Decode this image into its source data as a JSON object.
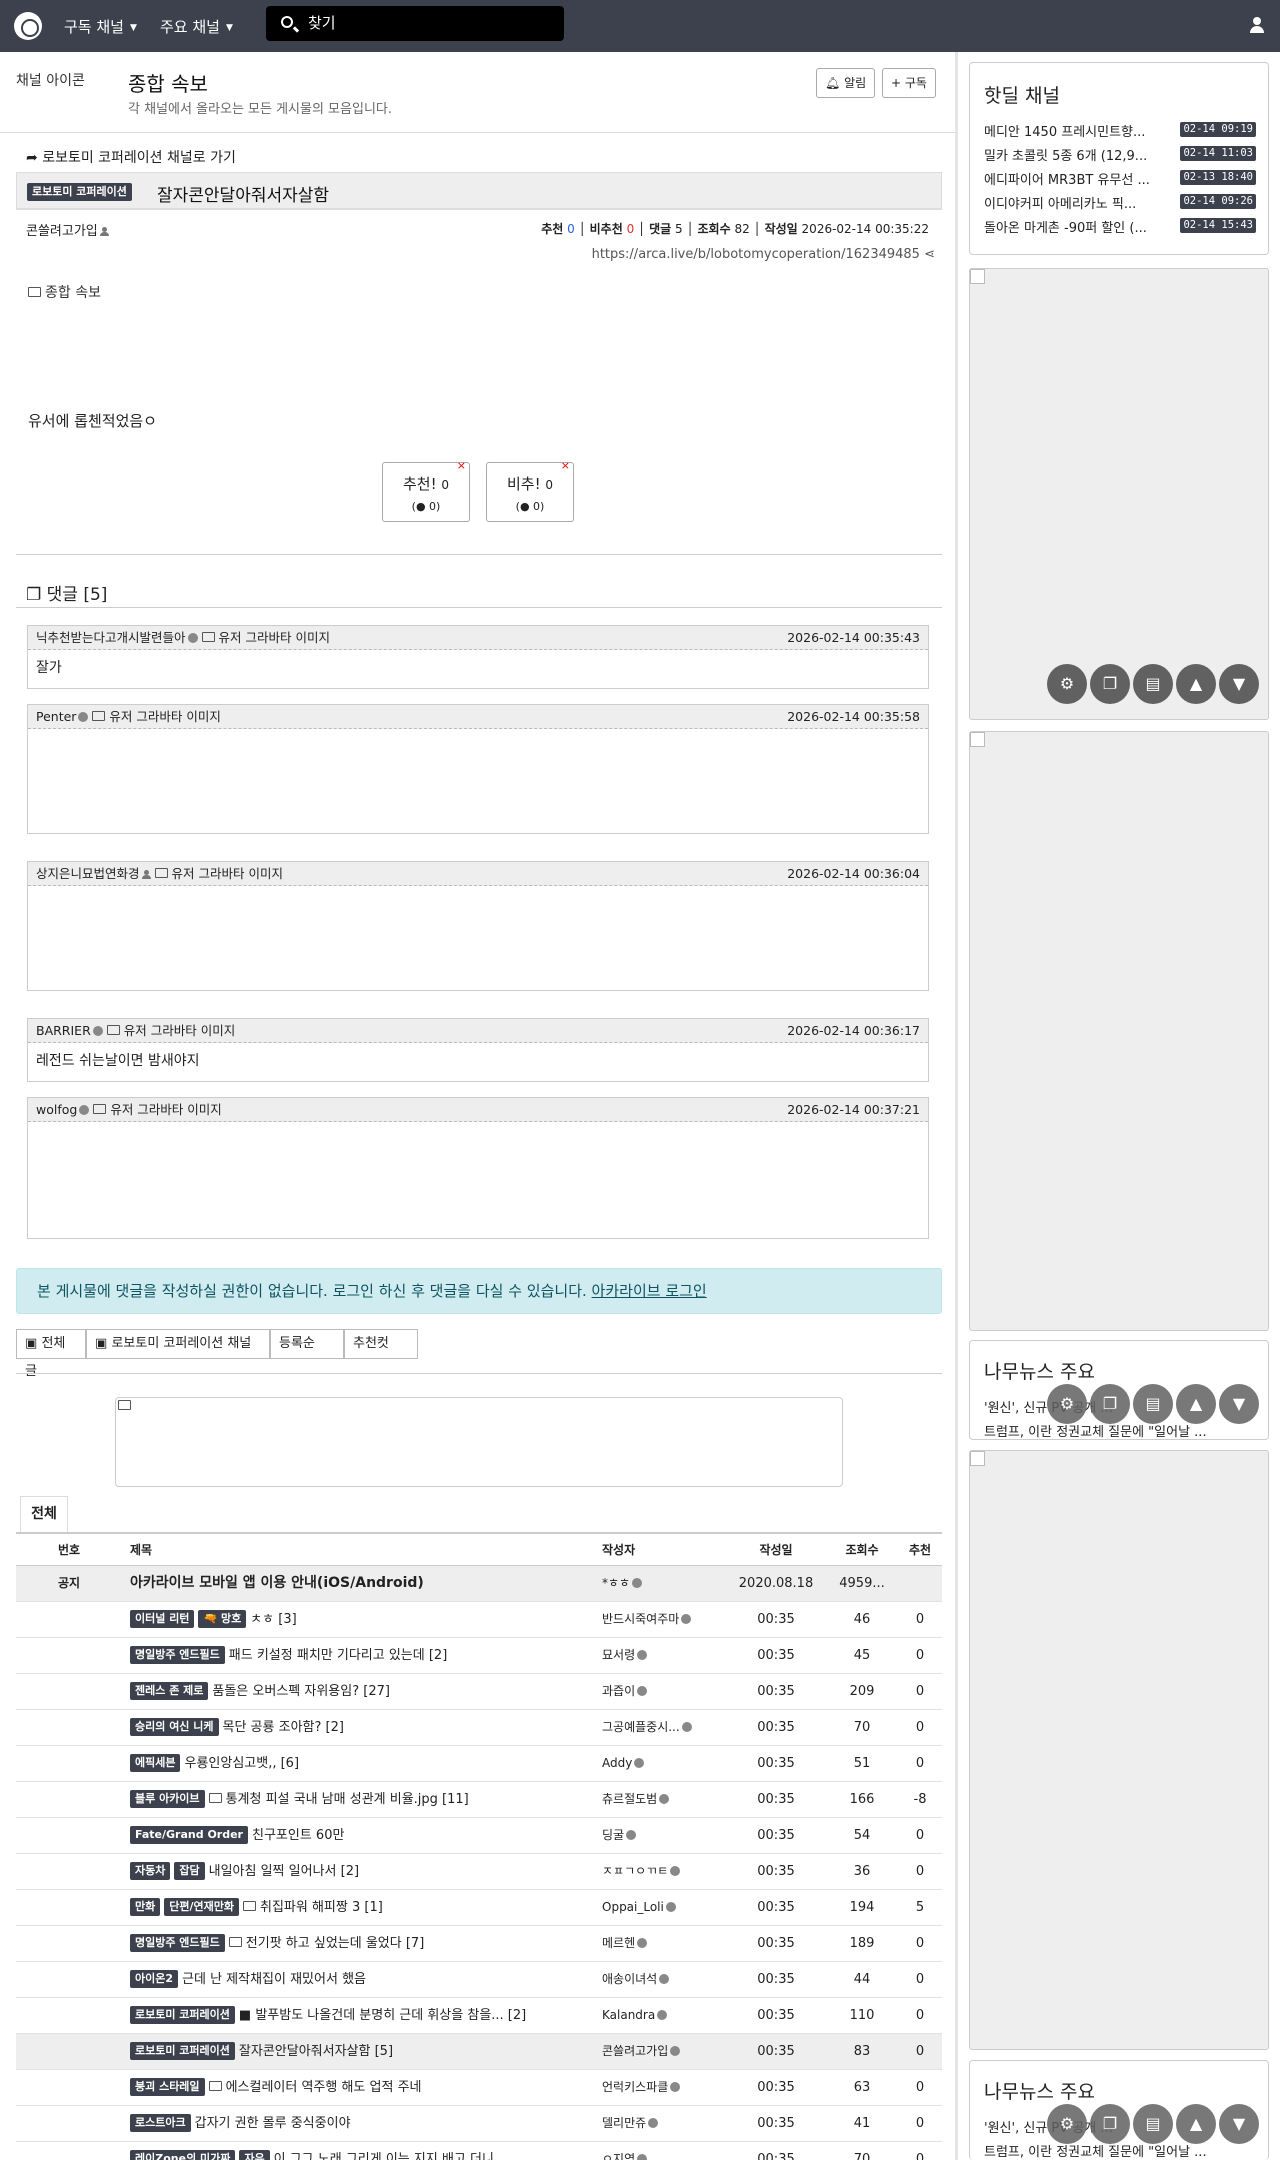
{
  "nav": {
    "subscribed_label": "구독 채널",
    "major_label": "주요 채널",
    "search_placeholder": "찾기"
  },
  "channel": {
    "image_alt": "채널 아이콘",
    "title": "종합 속보",
    "description": "각 채널에서 올라오는 모든 게시물의 모음입니다.",
    "alarm_label": "알림",
    "subscribe_label": "구독"
  },
  "post": {
    "back_link": "로보토미 코퍼레이션 채널로 가기",
    "category": "로보토미 코퍼레이션",
    "title": "잘자콘안달아줘서자살함",
    "author": "콘쓸려고가입",
    "stats": {
      "rec_label": "추천",
      "rec": "0",
      "unrec_label": "비추천",
      "unrec": "0",
      "cmt_label": "댓글",
      "cmt": "5",
      "view_label": "조회수",
      "view": "82",
      "date_label": "작성일",
      "date": "2026-02-14 00:35:22"
    },
    "url": "https://arca.live/b/lobotomycoperation/162349485",
    "image_alt": "종합 속보",
    "body": "유서에 롭첸적었음ㅇ",
    "vote_up": "추천!",
    "vote_up_count": "0",
    "vote_up_sub": "(● 0)",
    "vote_down": "비추!",
    "vote_down_count": "0",
    "vote_down_sub": "(● 0)"
  },
  "comments_header": "댓글 [5]",
  "comments": [
    {
      "author": "닉추천받는다고개시발련들아",
      "avatar_alt": "유저 그라바타 이미지",
      "time": "2026-02-14 00:35:43",
      "text": "잘가"
    },
    {
      "author": "Penter",
      "avatar_alt": "유저 그라바타 이미지",
      "time": "2026-02-14 00:35:58",
      "text": ""
    },
    {
      "author": "상지은니묘법연화경",
      "avatar_alt": "유저 그라바타 이미지",
      "time": "2026-02-14 00:36:04",
      "text": ""
    },
    {
      "author": "BARRIER",
      "avatar_alt": "유저 그라바타 이미지",
      "time": "2026-02-14 00:36:17",
      "text": "레전드 쉬는날이면 밤새야지"
    },
    {
      "author": "wolfog",
      "avatar_alt": "유저 그라바타 이미지",
      "time": "2026-02-14 00:37:21",
      "text": ""
    }
  ],
  "notice": {
    "text": "본 게시물에 댓글을 작성하실 권한이 없습니다. 로그인 하신 후 댓글을 다실 수 있습니다.",
    "link": "아카라이브 로그인"
  },
  "filters": {
    "all": "전체글",
    "channel": "로보토미 코퍼레이션 채널",
    "order": "등록순",
    "best": "추천컷"
  },
  "list": {
    "tab": "전체",
    "headers": {
      "num": "번호",
      "title": "제목",
      "author": "작성자",
      "date": "작성일",
      "views": "조회수",
      "rec": "추천"
    },
    "rows": [
      {
        "num": "공지",
        "badges": [],
        "title": "아카라이브 모바일 앱 이용 안내(iOS/Android)",
        "author": "*ㅎㅎ",
        "date": "2020.08.18",
        "views": "4959...",
        "rec": "",
        "bold": true
      },
      {
        "num": "",
        "badges": [
          "이터널 리턴",
          "🔫 망호"
        ],
        "title": "ㅊㅎ [3]",
        "author": "반드시죽여주마",
        "date": "00:35",
        "views": "46",
        "rec": "0"
      },
      {
        "num": "",
        "badges": [
          "명일방주 엔드필드"
        ],
        "title": "패드 키설정 패치만 기다리고 있는데 [2]",
        "author": "묘서령",
        "date": "00:35",
        "views": "45",
        "rec": "0"
      },
      {
        "num": "",
        "badges": [
          "젠레스 존 제로"
        ],
        "title": "품돌은 오버스펙 자위용임? [27]",
        "author": "과즙이",
        "date": "00:35",
        "views": "209",
        "rec": "0"
      },
      {
        "num": "",
        "badges": [
          "승리의 여신 니케"
        ],
        "title": "목단 공룡 조아함? [2]",
        "author": "그공예플중시...",
        "date": "00:35",
        "views": "70",
        "rec": "0"
      },
      {
        "num": "",
        "badges": [
          "에픽세븐"
        ],
        "title": "우룡인앙심고뱃,, [6]",
        "author": "Addy",
        "date": "00:35",
        "views": "51",
        "rec": "0"
      },
      {
        "num": "",
        "badges": [
          "블루 아카이브"
        ],
        "title": "통계청 피설 국내 남매 성관계 비율.jpg [11]",
        "author": "츄르절도범",
        "date": "00:35",
        "views": "166",
        "rec": "-8",
        "img": true
      },
      {
        "num": "",
        "badges": [
          "Fate/Grand Order"
        ],
        "title": "친구포인트 60만",
        "author": "딩굴",
        "date": "00:35",
        "views": "54",
        "rec": "0"
      },
      {
        "num": "",
        "badges": [
          "자동차",
          "잡담"
        ],
        "title": "내일아침 일찍 일어나서 [2]",
        "author": "ㅈㅍㄱㅇㄲㅌ",
        "date": "00:35",
        "views": "36",
        "rec": "0"
      },
      {
        "num": "",
        "badges": [
          "만화",
          "단편/연재만화"
        ],
        "title": "취집파워 해피짱 3 [1]",
        "author": "Oppai_Loli",
        "date": "00:35",
        "views": "194",
        "rec": "5",
        "img": true
      },
      {
        "num": "",
        "badges": [
          "명일방주 엔드필드"
        ],
        "title": "전기팟 하고 싶었는데 울었다 [7]",
        "author": "메르헨",
        "date": "00:35",
        "views": "189",
        "rec": "0",
        "img": true
      },
      {
        "num": "",
        "badges": [
          "아이온2"
        ],
        "title": "근데 난 제작채집이 재밌어서 했음",
        "author": "애송이녀석",
        "date": "00:35",
        "views": "44",
        "rec": "0"
      },
      {
        "num": "",
        "badges": [
          "로보토미 코퍼레이션"
        ],
        "title": "■ 발푸밤도 나올건데 분명히 근데 휘상을 참을... [2]",
        "author": "Kalandra",
        "date": "00:35",
        "views": "110",
        "rec": "0"
      },
      {
        "num": "",
        "badges": [
          "로보토미 코퍼레이션"
        ],
        "title": "잘자콘안달아줘서자살함 [5]",
        "author": "콘쓸려고가입",
        "date": "00:35",
        "views": "83",
        "rec": "0",
        "hl": true
      },
      {
        "num": "",
        "badges": [
          "붕괴 스타레일"
        ],
        "title": "에스컬레이터 역주행 해도 업적 주네",
        "author": "언럭키스파클",
        "date": "00:35",
        "views": "63",
        "rec": "0",
        "img": true
      },
      {
        "num": "",
        "badges": [
          "로스트아크"
        ],
        "title": "갑자기 권한 몰루 중식중이야",
        "author": "델리만쥬",
        "date": "00:35",
        "views": "41",
        "rec": "0"
      },
      {
        "num": "",
        "badges": [
          "레이Zone의 미가짜",
          "자유"
        ],
        "title": "이 그그 노래 그리게 이는 지지 배고 더니",
        "author": "ㅇ지역",
        "date": "00:35",
        "views": "70",
        "rec": "0"
      }
    ]
  },
  "sidebar": {
    "hotdeal_title": "핫딜 채널",
    "hotdeals": [
      {
        "title": "메디안 1450 프레시민트향...",
        "date": "02-14 09:19"
      },
      {
        "title": "밀카 초콜릿 5종 6개 (12,9...",
        "date": "02-14 11:03"
      },
      {
        "title": "에디파이어 MR3BT 유무선 ...",
        "date": "02-13 18:40"
      },
      {
        "title": "이디야커피 아메리카노 픽...",
        "date": "02-14 09:26"
      },
      {
        "title": "돌아온 마게촌 -90퍼 할인 (...",
        "date": "02-14 15:43"
      }
    ],
    "news_title": "나무뉴스 주요",
    "news": [
      "'원신', 신규 PV 공개 ...",
      "트럼프, 이란 정권교체 질문에 \"일어날 ..."
    ]
  }
}
